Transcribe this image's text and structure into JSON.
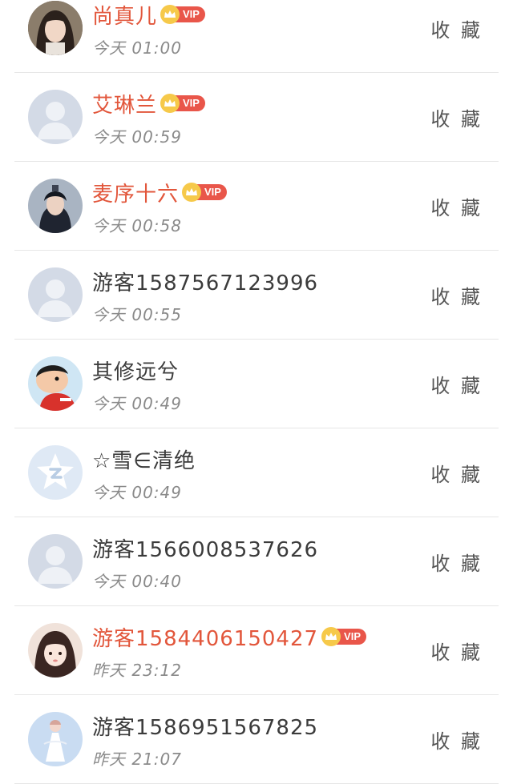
{
  "collect_label": "收 藏",
  "vip_label": "VIP",
  "items": [
    {
      "name": "尚真儿",
      "time": "今天 01:00",
      "vip": true,
      "avatar": "photo-girl-dark-hair-avatar"
    },
    {
      "name": "艾琳兰",
      "time": "今天 00:59",
      "vip": true,
      "avatar": "default-user-avatar"
    },
    {
      "name": "麦序十六",
      "time": "今天 00:58",
      "vip": true,
      "avatar": "photo-man-costume-avatar"
    },
    {
      "name": "游客1587567123996",
      "time": "今天 00:55",
      "vip": false,
      "avatar": "default-user-avatar"
    },
    {
      "name": "其修远兮",
      "time": "今天 00:49",
      "vip": false,
      "avatar": "cartoon-boy-avatar"
    },
    {
      "name": "☆雪∈清绝",
      "time": "今天 00:49",
      "vip": false,
      "avatar": "qq-star-avatar"
    },
    {
      "name": "游客1566008537626",
      "time": "今天 00:40",
      "vip": false,
      "avatar": "default-user-avatar"
    },
    {
      "name": "游客1584406150427",
      "time": "昨天 23:12",
      "vip": true,
      "avatar": "photo-girl-illustration-avatar"
    },
    {
      "name": "游客1586951567825",
      "time": "昨天 21:07",
      "vip": false,
      "avatar": "photo-girl-white-dress-avatar"
    }
  ],
  "colors": {
    "vip_name": "#e2563b",
    "normal_name": "#3b3b3b",
    "time": "#8a8a8a",
    "vip_badge": "#e9564a",
    "crown": "#f6c94a",
    "divider": "#e6e6e6"
  }
}
